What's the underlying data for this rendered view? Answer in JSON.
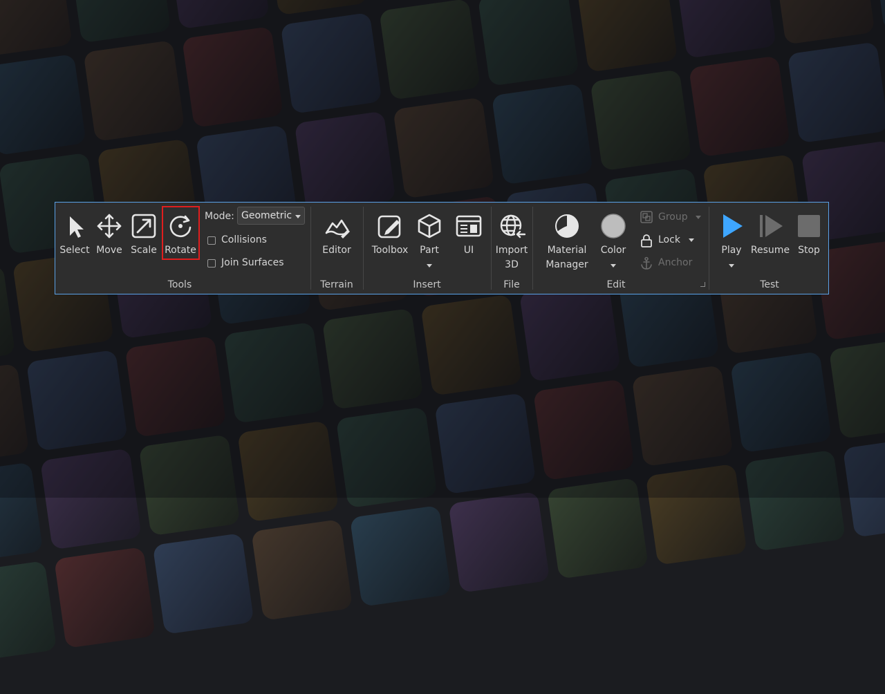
{
  "toolbar": {
    "tools": {
      "label": "Tools",
      "select": "Select",
      "move": "Move",
      "scale": "Scale",
      "rotate": "Rotate",
      "mode_label": "Mode:",
      "mode_value": "Geometric",
      "collisions": "Collisions",
      "join_surfaces": "Join Surfaces"
    },
    "terrain": {
      "label": "Terrain",
      "editor": "Editor"
    },
    "insert": {
      "label": "Insert",
      "toolbox": "Toolbox",
      "part": "Part",
      "ui": "UI"
    },
    "file": {
      "label": "File",
      "import_line1": "Import",
      "import_line2": "3D"
    },
    "edit": {
      "label": "Edit",
      "material_line1": "Material",
      "material_line2": "Manager",
      "color": "Color",
      "group": "Group",
      "lock": "Lock",
      "anchor": "Anchor"
    },
    "test": {
      "label": "Test",
      "play": "Play",
      "resume": "Resume",
      "stop": "Stop"
    }
  },
  "colors": {
    "toolbar_bg": "#2e2e2e",
    "border_accent": "#5aa2e8",
    "play_blue": "#3ea6ff",
    "highlight_red": "#e01e1e"
  }
}
